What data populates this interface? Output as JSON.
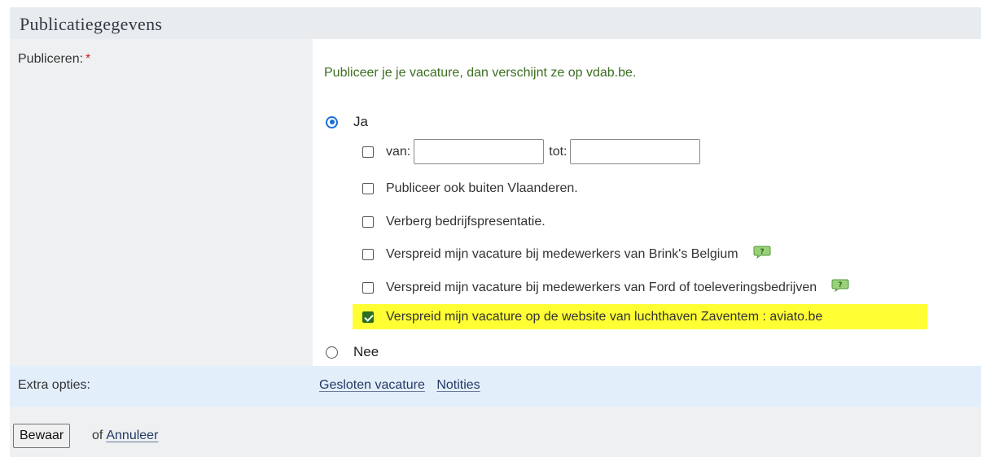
{
  "section": {
    "title": "Publicatiegegevens"
  },
  "publish": {
    "label": "Publiceren:",
    "required_mark": "*",
    "info": "Publiceer je je vacature, dan verschijnt ze op vdab.be.",
    "yes_label": "Ja",
    "no_label": "Nee",
    "selected": "Ja",
    "date_range": {
      "from_label": "van:",
      "to_label": "tot:",
      "from_value": "",
      "to_value": ""
    },
    "options": [
      {
        "label": "Publiceer ook buiten Vlaanderen.",
        "checked": false
      },
      {
        "label": "Verberg bedrijfspresentatie.",
        "checked": false
      },
      {
        "label": "Verspreid mijn vacature bij medewerkers van Brink's Belgium",
        "checked": false,
        "help_icon": "help-bubble-icon"
      },
      {
        "label": "Verspreid mijn vacature bij medewerkers van Ford of toeleveringsbedrijven",
        "checked": false,
        "help_icon": "help-bubble-icon"
      },
      {
        "label": "Verspreid mijn vacature op de website van luchthaven Zaventem : aviato.be",
        "checked": true,
        "highlighted": true
      }
    ]
  },
  "extra": {
    "label": "Extra opties:",
    "links": [
      "Gesloten vacature",
      "Notities"
    ]
  },
  "footer": {
    "save_label": "Bewaar",
    "or_text": "of",
    "cancel_label": "Annuleer"
  },
  "colors": {
    "header_bg": "#e8ecee",
    "info_text": "#3c6f21",
    "highlight": "#ffff33",
    "checkbox_checked": "#2b6e21",
    "radio_selected": "#1a6fd8",
    "extra_bg": "#e3eefb",
    "required": "#d0202a"
  }
}
